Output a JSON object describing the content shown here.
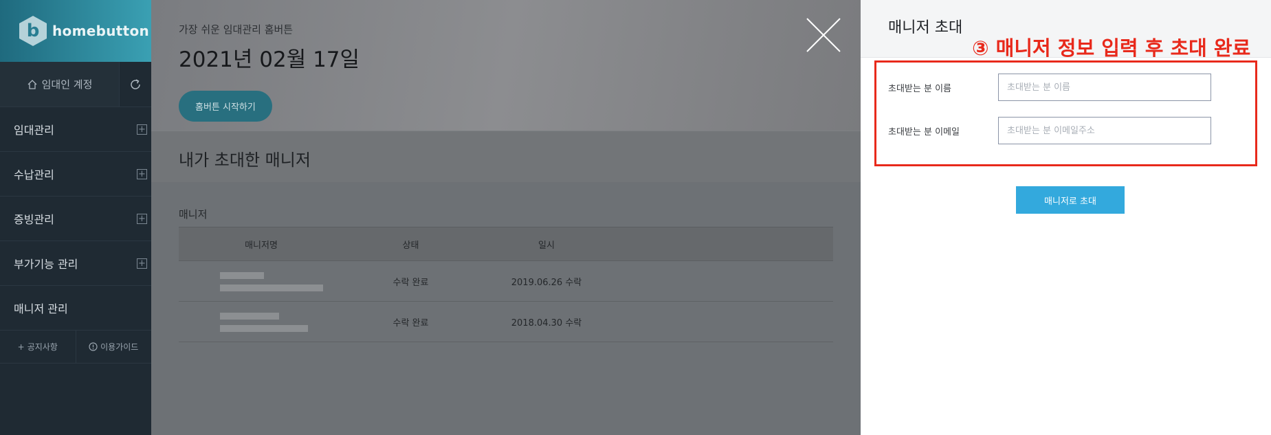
{
  "sidebar": {
    "logo_text": "homebutton",
    "account_label": "임대인 계정",
    "menu": [
      {
        "label": "임대관리"
      },
      {
        "label": "수납관리"
      },
      {
        "label": "증빙관리"
      },
      {
        "label": "부가기능 관리"
      },
      {
        "label": "매니저 관리"
      }
    ],
    "notice_label": "공지사항",
    "guide_label": "이용가이드"
  },
  "main": {
    "subtitle": "가장 쉬운 임대관리 홈버튼",
    "date": "2021년 02월 17일",
    "start_button": "홈버튼 시작하기",
    "section_title": "내가 초대한 매니저",
    "table_label": "매니저",
    "columns": [
      "매니저명",
      "상태",
      "일시"
    ],
    "rows": [
      {
        "status": "수락 완료",
        "date": "2019.06.26 수락"
      },
      {
        "status": "수락 완료",
        "date": "2018.04.30 수락"
      }
    ]
  },
  "panel": {
    "title": "매니저 초대",
    "annotation": "③ 매니저 정보 입력 후 초대 완료",
    "name_label": "초대받는 분 이름",
    "name_placeholder": "초대받는 분 이름",
    "email_label": "초대받는 분 이메일",
    "email_placeholder": "초대받는 분 이메일주소",
    "invite_button": "매니저로 초대"
  },
  "colors": {
    "accent": "#33a9dd",
    "annotation_red": "#e8291b",
    "sidebar_bg": "#1f2a33"
  }
}
